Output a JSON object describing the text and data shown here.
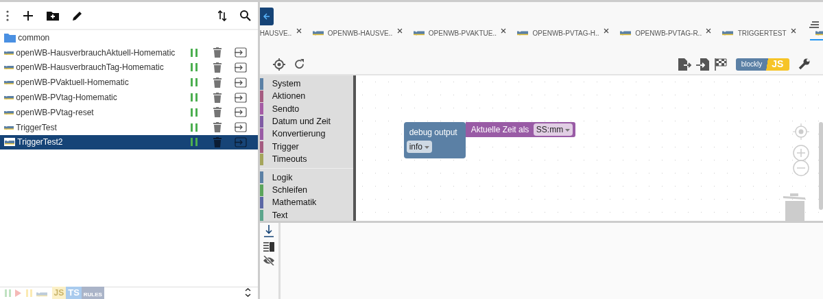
{
  "sidebar": {
    "items": [
      {
        "kind": "folder",
        "name": "common",
        "selected": false
      },
      {
        "kind": "script",
        "name": "openWB-HausverbrauchAktuell-Homematic",
        "selected": false,
        "running": true
      },
      {
        "kind": "script",
        "name": "openWB-HausverbrauchTag-Homematic",
        "selected": false,
        "running": true
      },
      {
        "kind": "script",
        "name": "openWB-PVaktuell-Homematic",
        "selected": false,
        "running": true
      },
      {
        "kind": "script",
        "name": "openWB-PVtag-Homematic",
        "selected": false,
        "running": true
      },
      {
        "kind": "script",
        "name": "openWB-PVtag-reset",
        "selected": false,
        "running": true
      },
      {
        "kind": "script",
        "name": "TriggerTest",
        "selected": false,
        "running": true
      },
      {
        "kind": "script",
        "name": "TriggerTest2",
        "selected": true,
        "running": true
      }
    ]
  },
  "filter_bar": {
    "badges": [
      "JS",
      "TS",
      "RULES"
    ]
  },
  "tabs": [
    {
      "label": "HAUSVE..",
      "icon": false,
      "selected": false
    },
    {
      "label": "OPENWB-HAUSVE..",
      "icon": true,
      "selected": false
    },
    {
      "label": "OPENWB-PVAKTUE..",
      "icon": true,
      "selected": false
    },
    {
      "label": "OPENWB-PVTAG-H..",
      "icon": true,
      "selected": false
    },
    {
      "label": "OPENWB-PVTAG-R..",
      "icon": true,
      "selected": false
    },
    {
      "label": "TRIGGERTEST",
      "icon": true,
      "selected": false
    },
    {
      "icon": true,
      "selected": true
    }
  ],
  "toolbar": {
    "blockly_label": "blockly",
    "js_label": "JS"
  },
  "toolbox": {
    "groups": [
      [
        {
          "label": "System",
          "color": "#5b80a5"
        },
        {
          "label": "Aktionen",
          "color": "#a55b80"
        },
        {
          "label": "Sendto",
          "color": "#a55ba5"
        },
        {
          "label": "Datum und Zeit",
          "color": "#805ba5"
        },
        {
          "label": "Konvertierung",
          "color": "#995ba5"
        },
        {
          "label": "Trigger",
          "color": "#a55b80"
        },
        {
          "label": "Timeouts",
          "color": "#a5a55b"
        }
      ],
      [
        {
          "label": "Logik",
          "color": "#5b80a5"
        },
        {
          "label": "Schleifen",
          "color": "#5ba55b"
        },
        {
          "label": "Mathematik",
          "color": "#5b67a5"
        },
        {
          "label": "Text",
          "color": "#5ba58c"
        }
      ]
    ]
  },
  "workspace": {
    "debug_block": {
      "label": "debug output",
      "level": "info"
    },
    "time_block": {
      "label": "Aktuelle Zeit als",
      "format": "SS:mm"
    }
  }
}
